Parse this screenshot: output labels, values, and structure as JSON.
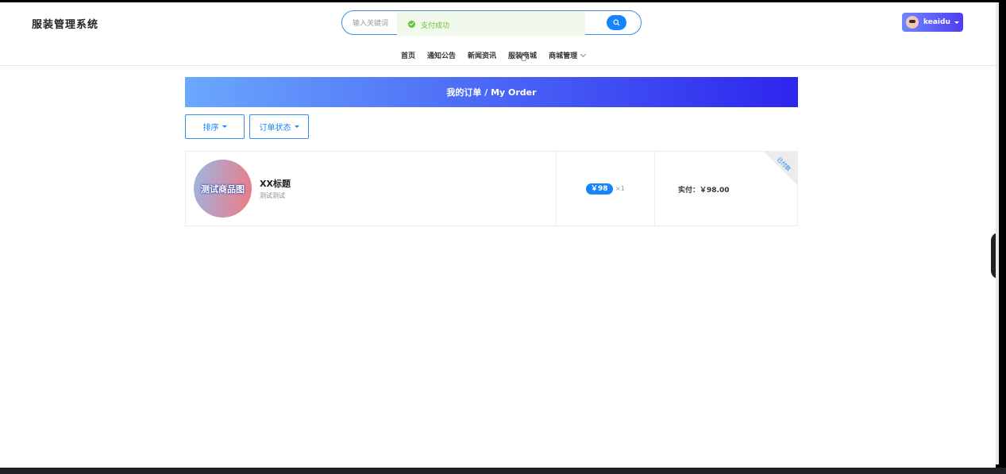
{
  "header": {
    "logo": "服装管理系统",
    "search_placeholder": "输入关键词",
    "toast_message": "支付成功",
    "user_name": "keaidu"
  },
  "nav": {
    "items": [
      "首页",
      "通知公告",
      "新闻资讯",
      "服装商城",
      "商城管理"
    ]
  },
  "banner": {
    "title": "我的订单 / My Order"
  },
  "filters": {
    "sort_label": "排序",
    "status_label": "订单状态"
  },
  "order": {
    "thumb_text": "测试商品图",
    "title": "XX标题",
    "description": "测试测试",
    "price": "￥98",
    "quantity": "×1",
    "paid_amount": "实付：￥98.00",
    "status": "已付款"
  },
  "colors": {
    "accent": "#1684fc",
    "success": "#67c23a"
  }
}
